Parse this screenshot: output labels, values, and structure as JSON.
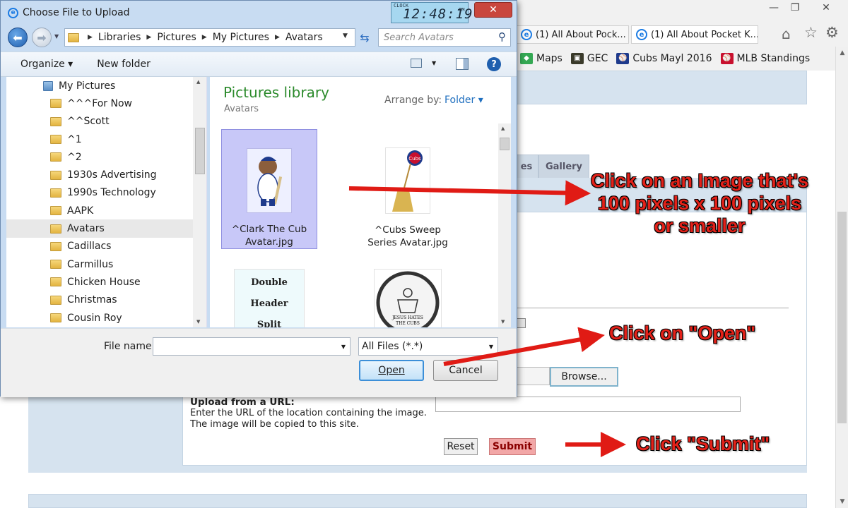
{
  "dialog": {
    "title": "Choose File to Upload",
    "clock": {
      "label": "CLOCK",
      "time": "12:48:19",
      "ampm": "PM"
    },
    "close_label": "✕",
    "breadcrumb": [
      "Libraries",
      "Pictures",
      "My Pictures",
      "Avatars"
    ],
    "search_placeholder": "Search Avatars",
    "toolbar": {
      "organize": "Organize ▾",
      "new_folder": "New folder",
      "help": "?"
    },
    "nav": {
      "root": "My Pictures",
      "items": [
        "^^^For Now",
        "^^Scott",
        "^1",
        "^2",
        "1930s Advertising",
        "1990s Technology",
        "AAPK",
        "Avatars",
        "Cadillacs",
        "Carmillus",
        "Chicken House",
        "Christmas",
        "Cousin Roy"
      ],
      "selected": "Avatars"
    },
    "library": {
      "title": "Pictures library",
      "subtitle": "Avatars",
      "arrange_label": "Arrange by:",
      "arrange_value": "Folder ▾"
    },
    "files": [
      {
        "name": "^Clark The Cub Avatar.jpg",
        "selected": true
      },
      {
        "name": "^Cubs Sweep Series Avatar.jpg",
        "selected": false
      },
      {
        "name": "",
        "image_text": [
          "Double Header",
          "Split"
        ],
        "selected": false
      },
      {
        "name": "",
        "image_text": [
          "JESUS HATES",
          "THE CUBS"
        ],
        "selected": false
      }
    ],
    "cubs_logo_text": "Cubs",
    "filename_label": "File name:",
    "filename_value": "",
    "filetype_value": "All Files (*.*)",
    "open_label": "Open",
    "cancel_label": "Cancel"
  },
  "browser": {
    "tabs": [
      "(1) All About Pock...",
      "(1) All About Pocket K..."
    ],
    "favorites": [
      "Maps",
      "GEC",
      "Cubs Mayl 2016",
      "MLB Standings"
    ],
    "page": {
      "gallery_tab": "Gallery",
      "partial_tab": "es",
      "browse_label": "Browse...",
      "url_heading": "Upload from a URL:",
      "url_desc": "Enter the URL of the location containing the image.",
      "url_note": "The image will be copied to this site.",
      "reset_label": "Reset",
      "submit_label": "Submit"
    }
  },
  "annotations": {
    "image_hint": [
      "Click on an Image that's",
      "100 pixels x 100 pixels",
      "or smaller"
    ],
    "open_hint": "Click on \"Open\"",
    "submit_hint": "Click \"Submit\""
  },
  "colors": {
    "accent": "#1b7be3",
    "arrow": "#e01b15",
    "title_green": "#2b8a2b",
    "submit": "#f2a7a7"
  }
}
